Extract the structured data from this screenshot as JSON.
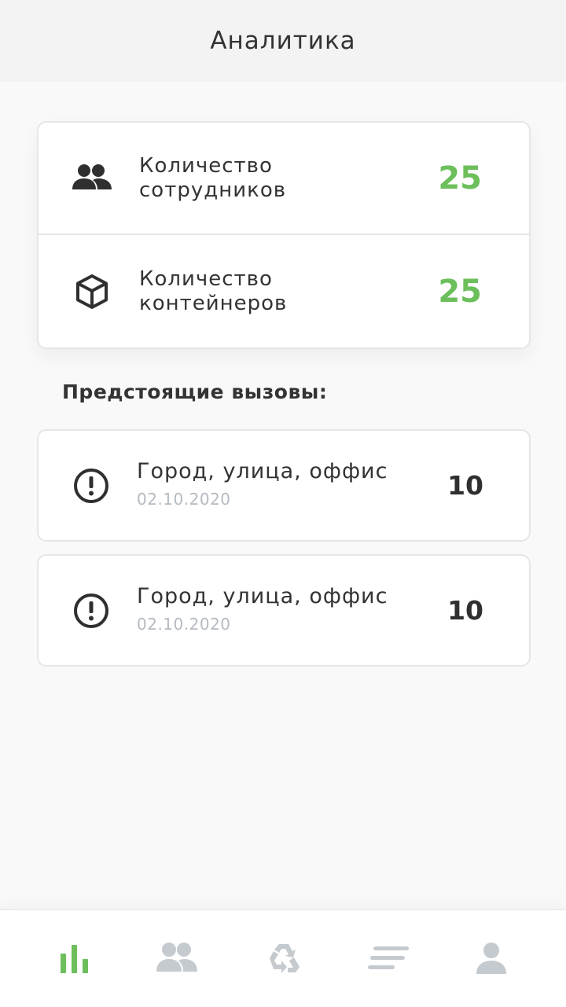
{
  "header": {
    "title": "Аналитика"
  },
  "stats": [
    {
      "label_line1": "Количество",
      "label_line2": "сотрудников",
      "value": "25",
      "icon": "people-icon"
    },
    {
      "label_line1": "Количество",
      "label_line2": "контейнеров",
      "value": "25",
      "icon": "box-icon"
    }
  ],
  "upcoming": {
    "title": "Предстоящие вызовы:",
    "items": [
      {
        "address": "Город, улица, оффис",
        "date": "02.10.2020",
        "count": "10",
        "icon": "alert-circle-icon"
      },
      {
        "address": "Город, улица, оффис",
        "date": "02.10.2020",
        "count": "10",
        "icon": "alert-circle-icon"
      }
    ]
  },
  "tabbar": {
    "tabs": [
      {
        "icon": "bar-chart-icon",
        "active": true
      },
      {
        "icon": "people-icon",
        "active": false
      },
      {
        "icon": "recycle-icon",
        "active": false
      },
      {
        "icon": "list-icon",
        "active": false
      },
      {
        "icon": "user-icon",
        "active": false
      }
    ]
  },
  "colors": {
    "accent": "#6cbf5b",
    "inactive": "#c5cacf",
    "text": "#333333",
    "muted": "#b5bac1"
  }
}
